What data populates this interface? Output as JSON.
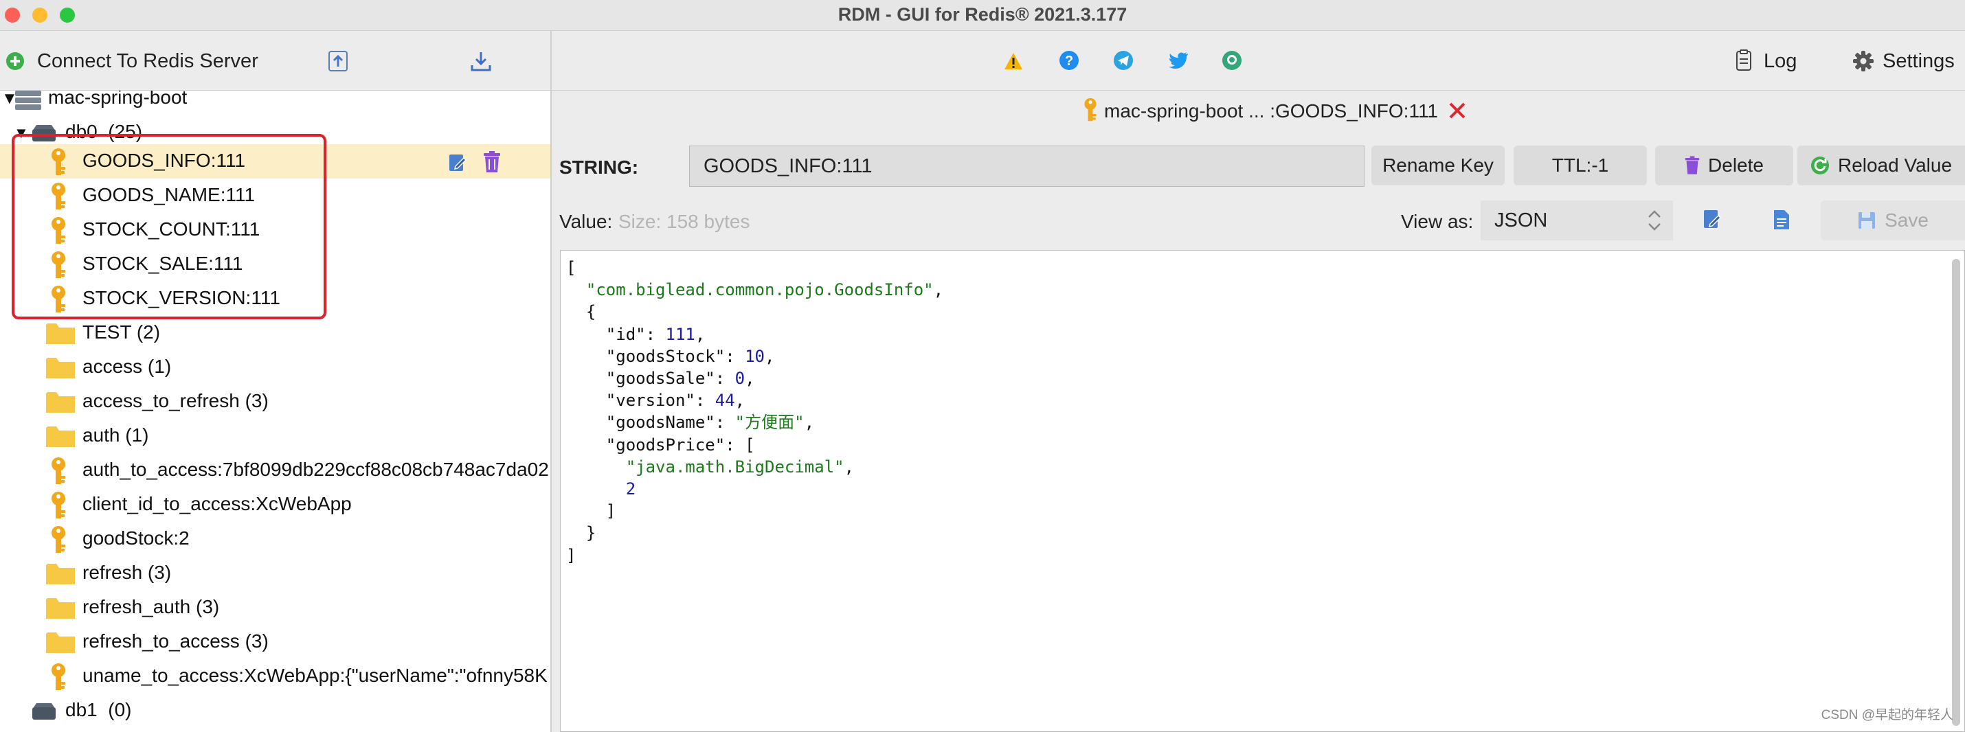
{
  "window": {
    "title": "RDM - GUI for Redis® 2021.3.177"
  },
  "toolbar": {
    "connect_label": "Connect To Redis Server",
    "log_label": "Log",
    "settings_label": "Settings"
  },
  "tree": {
    "connection_name": "mac-spring-boot",
    "db0_label": "db0",
    "db0_count": "(25)",
    "keys_selected_group": [
      "GOODS_INFO:111",
      "GOODS_NAME:111",
      "STOCK_COUNT:111",
      "STOCK_SALE:111",
      "STOCK_VERSION:111"
    ],
    "items": [
      {
        "type": "folder",
        "label": "TEST (2)"
      },
      {
        "type": "folder",
        "label": "access (1)"
      },
      {
        "type": "folder",
        "label": "access_to_refresh (3)"
      },
      {
        "type": "folder",
        "label": "auth (1)"
      },
      {
        "type": "key",
        "label": "auth_to_access:7bf8099db229ccf88c08cb748ac7da02"
      },
      {
        "type": "key",
        "label": "client_id_to_access:XcWebApp"
      },
      {
        "type": "key",
        "label": "goodStock:2"
      },
      {
        "type": "folder",
        "label": "refresh (3)"
      },
      {
        "type": "folder",
        "label": "refresh_auth (3)"
      },
      {
        "type": "folder",
        "label": "refresh_to_access (3)"
      },
      {
        "type": "key",
        "label": "uname_to_access:XcWebApp:{\"userName\":\"ofnny58K"
      }
    ],
    "db1_label": "db1",
    "db1_count": "(0)"
  },
  "tab": {
    "title": "mac-spring-boot ... :GOODS_INFO:111"
  },
  "key_panel": {
    "type_label": "STRING:",
    "key_name": "GOODS_INFO:111",
    "rename_label": "Rename Key",
    "ttl_label": "TTL:-1",
    "delete_label": "Delete",
    "reload_label": "Reload Value",
    "value_label": "Value:",
    "size_label": "Size: 158 bytes",
    "view_as_label": "View as:",
    "view_as_value": "JSON",
    "save_label": "Save"
  },
  "value_json": {
    "class_name": "\"com.biglead.common.pojo.GoodsInfo\"",
    "id_key": "\"id\"",
    "id_val": "111",
    "stock_key": "\"goodsStock\"",
    "stock_val": "10",
    "sale_key": "\"goodsSale\"",
    "sale_val": "0",
    "version_key": "\"version\"",
    "version_val": "44",
    "name_key": "\"goodsName\"",
    "name_val": "\"方便面\"",
    "price_key": "\"goodsPrice\"",
    "price_class": "\"java.math.BigDecimal\"",
    "price_val": "2"
  },
  "watermark": "CSDN @早起的年轻人",
  "colors": {
    "selection_box": "#e0202a",
    "selected_row": "#fcefc7",
    "key_icon": "#f0a81a",
    "folder_icon": "#f7c843"
  }
}
